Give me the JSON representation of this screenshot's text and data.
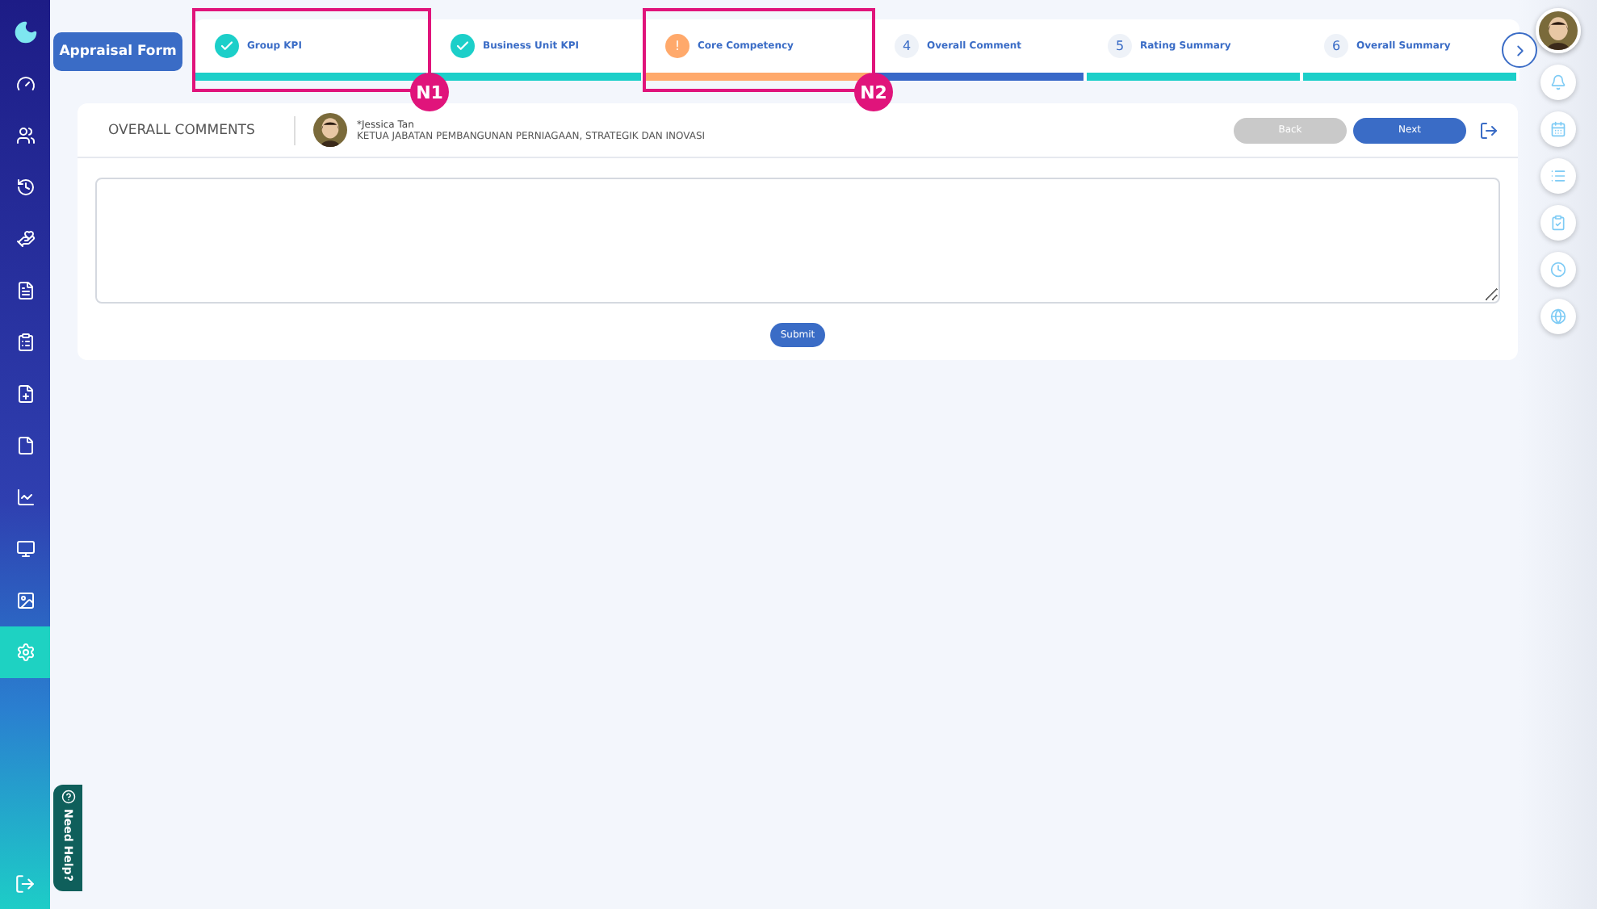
{
  "header": {
    "title_button": "Appraisal Form"
  },
  "steps": [
    {
      "label": "Group KPI",
      "kind": "done",
      "color": "#1ccfc9",
      "annotation": "N1"
    },
    {
      "label": "Business Unit KPI",
      "kind": "done",
      "color": "#1ccfc9"
    },
    {
      "label": "Core Competency",
      "kind": "warning",
      "marker": "!",
      "color": "#ffa96b",
      "annotation": "N2"
    },
    {
      "label": "Overall Comment",
      "kind": "pending",
      "marker": "4",
      "color": "#3868c8"
    },
    {
      "label": "Rating Summary",
      "kind": "pending",
      "marker": "5",
      "color": "#1ccfc9"
    },
    {
      "label": "Overall Summary",
      "kind": "pending",
      "marker": "6",
      "color": "#1ccfc9"
    }
  ],
  "panel": {
    "title": "OVERALL COMMENTS",
    "employee": {
      "name": "*Jessica Tan",
      "position": "KETUA JABATAN PEMBANGUNAN PERNIAGAAN, STRATEGIK DAN INOVASI"
    },
    "back_button": {
      "label": "Back",
      "disabled": true
    },
    "next_button": {
      "label": "Next",
      "disabled": false
    },
    "submit_button": "Submit"
  },
  "sidebar": {
    "items": [
      {
        "selected": false
      },
      {
        "selected": false
      },
      {
        "selected": false
      },
      {
        "selected": false
      },
      {
        "selected": false
      },
      {
        "selected": false
      },
      {
        "selected": false
      },
      {
        "selected": false
      },
      {
        "selected": false
      },
      {
        "selected": false
      },
      {
        "selected": false
      },
      {
        "selected": true
      }
    ]
  },
  "help_tab": "Need Help?"
}
